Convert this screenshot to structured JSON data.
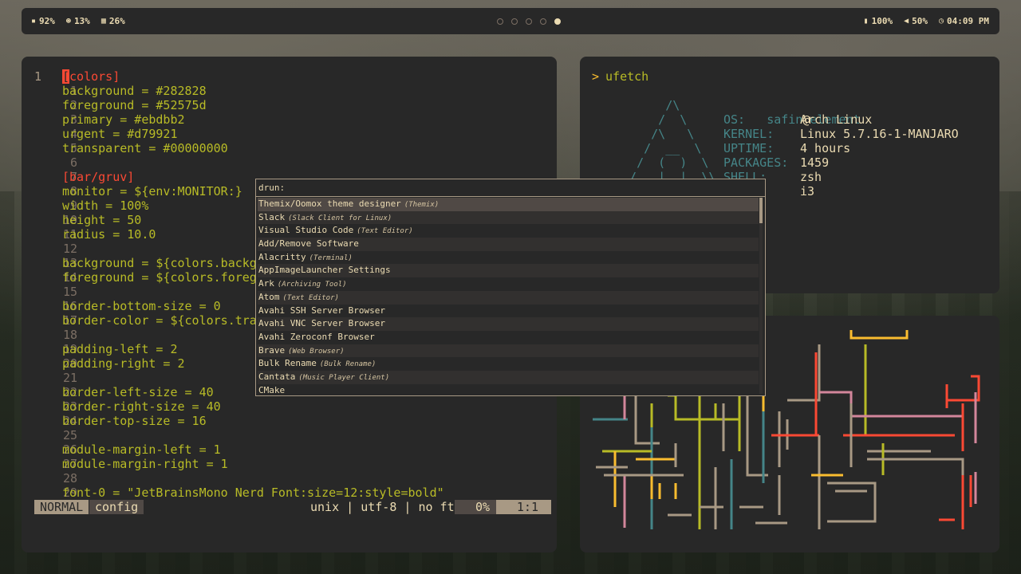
{
  "colors": {
    "yellow": "#fabd2f",
    "green": "#b8bb26",
    "red": "#fb4934",
    "aqua": "#458588",
    "fg": "#ebdbb2",
    "gray": "#a89984",
    "pink": "#d3869b",
    "teal": "#689d6a",
    "orange": "#d79921"
  },
  "topbar": {
    "left_modules": [
      {
        "icon": "disk-icon",
        "glyph": "▪",
        "value": "92%"
      },
      {
        "icon": "cpu-icon",
        "glyph": "⊛",
        "value": "13%"
      },
      {
        "icon": "memory-icon",
        "glyph": "▦",
        "value": "26%"
      }
    ],
    "workspaces": [
      {
        "active": false
      },
      {
        "active": false
      },
      {
        "active": false
      },
      {
        "active": false
      },
      {
        "active": true
      }
    ],
    "right_modules": [
      {
        "icon": "battery-icon",
        "glyph": "▮",
        "value": "100%"
      },
      {
        "icon": "volume-icon",
        "glyph": "◀",
        "value": "50%"
      },
      {
        "icon": "clock-icon",
        "glyph": "◷",
        "value": "04:09 PM"
      }
    ]
  },
  "editor": {
    "lines": [
      {
        "num": "1",
        "text": "[colors]",
        "kind": "section",
        "first": true
      },
      {
        "num": "1",
        "text": "background = #282828"
      },
      {
        "num": "2",
        "text": "foreground = #52575d"
      },
      {
        "num": "3",
        "text": "primary = #ebdbb2"
      },
      {
        "num": "4",
        "text": "urgent = #d79921"
      },
      {
        "num": "5",
        "text": "transparent = #00000000"
      },
      {
        "num": "6",
        "text": ""
      },
      {
        "num": "7",
        "text": "[bar/gruv]",
        "kind": "section"
      },
      {
        "num": "8",
        "text": "monitor = ${env:MONITOR:}"
      },
      {
        "num": "9",
        "text": "width = 100%"
      },
      {
        "num": "10",
        "text": "height = 50"
      },
      {
        "num": "11",
        "text": "radius = 10.0"
      },
      {
        "num": "12",
        "text": ""
      },
      {
        "num": "13",
        "text": "background = ${colors.backgr"
      },
      {
        "num": "14",
        "text": "foreground = ${colors.foregr"
      },
      {
        "num": "15",
        "text": ""
      },
      {
        "num": "16",
        "text": "border-bottom-size = 0"
      },
      {
        "num": "17",
        "text": "border-color = ${colors.tran"
      },
      {
        "num": "18",
        "text": ""
      },
      {
        "num": "19",
        "text": "padding-left = 2"
      },
      {
        "num": "20",
        "text": "padding-right = 2"
      },
      {
        "num": "21",
        "text": ""
      },
      {
        "num": "22",
        "text": "border-left-size = 40"
      },
      {
        "num": "23",
        "text": "border-right-size = 40"
      },
      {
        "num": "24",
        "text": "border-top-size = 16"
      },
      {
        "num": "25",
        "text": ""
      },
      {
        "num": "26",
        "text": "module-margin-left = 1"
      },
      {
        "num": "27",
        "text": "module-margin-right = 1"
      },
      {
        "num": "28",
        "text": ""
      },
      {
        "num": "29",
        "text": "font-0 = \"JetBrainsMono Nerd Font:size=12:style=bold\""
      }
    ],
    "status": {
      "mode": "NORMAL",
      "file": "config",
      "encoding": "unix | utf-8 | no ft",
      "percent": "0%",
      "position": "1:1"
    }
  },
  "terminal": {
    "prompt_arrow": ">",
    "command": "ufetch",
    "user": "safin",
    "at": "@",
    "host": "element",
    "info": [
      {
        "key": "OS:",
        "value": "Arch Linux"
      },
      {
        "key": "KERNEL:",
        "value": "Linux 5.7.16-1-MANJARO"
      },
      {
        "key": "UPTIME:",
        "value": "4 hours"
      },
      {
        "key": "PACKAGES:",
        "value": "1459"
      },
      {
        "key": "SHELL:",
        "value": "zsh"
      },
      {
        "key": "",
        "value": "i3"
      }
    ]
  },
  "rofi": {
    "prompt": "drun:",
    "items": [
      {
        "name": "Themix/Oomox theme designer",
        "desc": "(Themix)"
      },
      {
        "name": "Slack",
        "desc": "(Slack Client for Linux)"
      },
      {
        "name": "Visual Studio Code",
        "desc": "(Text Editor)"
      },
      {
        "name": "Add/Remove Software",
        "desc": ""
      },
      {
        "name": "Alacritty",
        "desc": "(Terminal)"
      },
      {
        "name": "AppImageLauncher Settings",
        "desc": ""
      },
      {
        "name": "Ark",
        "desc": "(Archiving Tool)"
      },
      {
        "name": "Atom",
        "desc": "(Text Editor)"
      },
      {
        "name": "Avahi SSH Server Browser",
        "desc": ""
      },
      {
        "name": "Avahi VNC Server Browser",
        "desc": ""
      },
      {
        "name": "Avahi Zeroconf Browser",
        "desc": ""
      },
      {
        "name": "Brave",
        "desc": "(Web Browser)"
      },
      {
        "name": "Bulk Rename",
        "desc": "(Bulk Rename)"
      },
      {
        "name": "Cantata",
        "desc": "(Music Player Client)"
      },
      {
        "name": "CMake",
        "desc": ""
      }
    ],
    "selected_index": 0
  }
}
